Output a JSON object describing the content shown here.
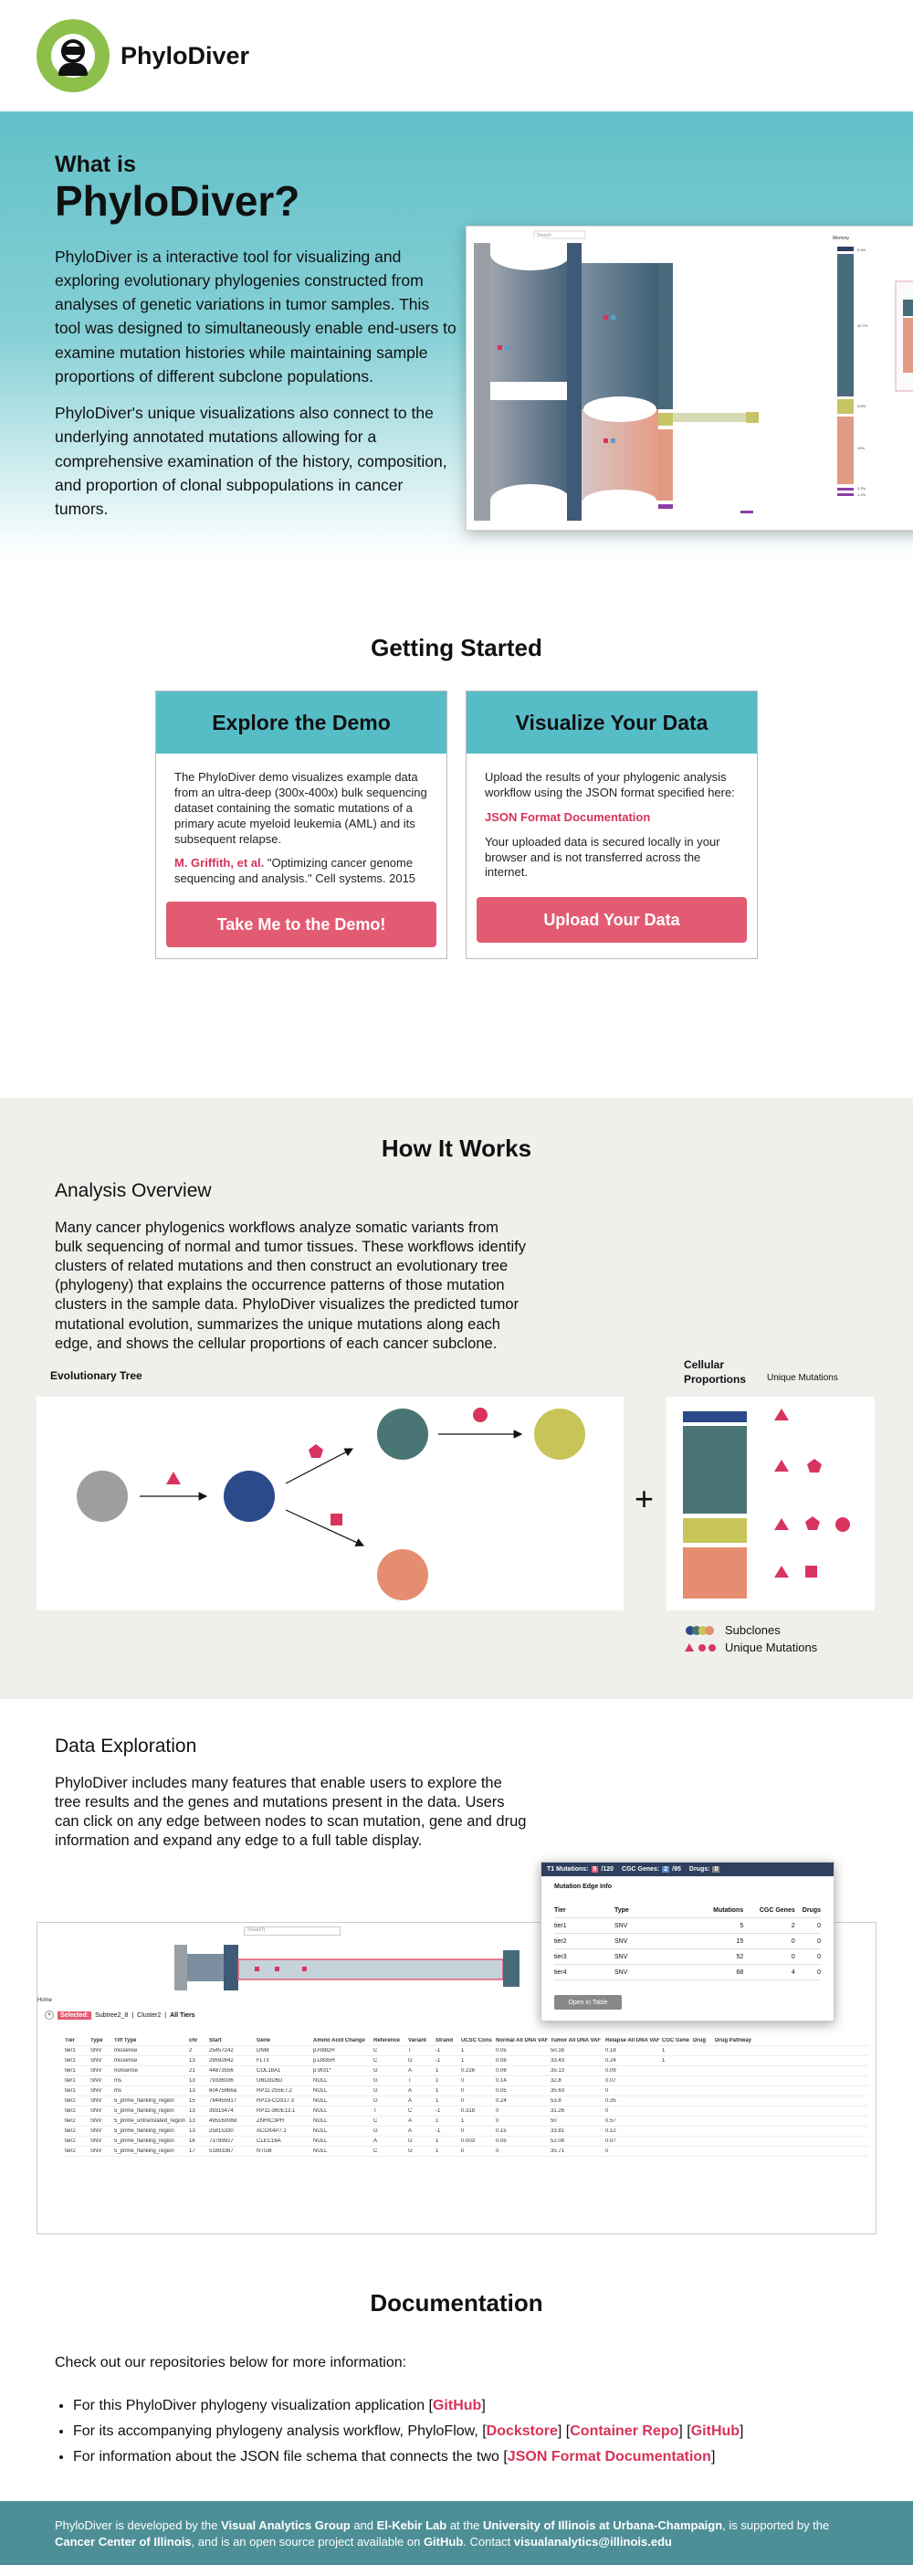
{
  "brand": {
    "name": "PhyloDiver"
  },
  "hero": {
    "pre_title": "What is",
    "title": "PhyloDiver?",
    "para1": "PhyloDiver is a interactive tool for visualizing and exploring evolutionary phylogenies constructed from analyses of genetic variations in tumor samples. This tool was designed to simultaneously enable end-users to examine mutation histories while maintaining sample proportions of different subclone populations.",
    "para2": "PhyloDiver's unique visualizations also connect to the underlying annotated mutations allowing for a comprehensive examination of the history, composition, and proportion of clonal subpopulations in cancer tumors.",
    "shot": {
      "search_placeholder": "Search",
      "memory_label": "Memory",
      "pct_top": "5.4%",
      "pct_mid": "42.7%",
      "pct_low1": "5.8%",
      "pct_low2": "29%",
      "pct_b1": "2.2%",
      "pct_b2": "1.2%"
    }
  },
  "getting_started": {
    "title": "Getting Started",
    "demo": {
      "title": "Explore the Demo",
      "text": "The PhyloDiver demo visualizes example data from an ultra-deep (300x-400x) bulk sequencing dataset containing the somatic mutations of a primary acute myeloid leukemia (AML) and its subsequent relapse.",
      "citation_authors": "M. Griffith, et al.",
      "citation_rest": " \"Optimizing cancer genome sequencing and analysis.\" Cell systems. 2015",
      "button": "Take Me to the Demo!"
    },
    "upload": {
      "title": "Visualize Your Data",
      "text": "Upload the results of your phylogenic analysis workflow using the JSON format specified here:",
      "link": "JSON Format Documentation",
      "text2": "Your uploaded data is secured locally in your browser and is not transferred across the internet.",
      "button": "Upload Your Data"
    }
  },
  "how": {
    "title": "How It Works",
    "overview_title": "Analysis Overview",
    "overview_text": "Many cancer phylogenics workflows analyze somatic variants from bulk sequencing of normal and tumor tissues. These workflows identify clusters of related mutations and then construct an evolutionary tree (phylogeny) that explains the occurrence patterns of those mutation clusters in the sample data. PhyloDiver visualizes the predicted tumor mutational evolution, summarizes the unique mutations along each edge, and shows the cellular proportions of each cancer subclone.",
    "tree_label": "Evolutionary Tree",
    "cell_prop_label": "Cellular Proportions",
    "unique_mut_label": "Unique Mutations",
    "plus": "+",
    "legend_subclones": "Subclones",
    "legend_unique": "Unique Mutations",
    "colors": {
      "gray": "#9e9e9e",
      "navy": "#2a4a8a",
      "teal": "#497574",
      "olive": "#c8c558",
      "salmon": "#e58e6f",
      "pink": "#d8345f"
    }
  },
  "explore": {
    "title": "Data Exploration",
    "text": "PhyloDiver includes many features that enable users to explore the tree results and the genes and mutations present in the data. Users can click on any edge between nodes to scan mutation, gene and drug information and expand any edge to a full table display.",
    "popup": {
      "header_t1": "T1 Mutations:",
      "t1_count": "5",
      "t1_total": "/120",
      "cgc_label": "CGC Genes:",
      "cgc_count": "2",
      "cgc_total": "/95",
      "drugs_label": "Drugs:",
      "drugs_count": "0",
      "section": "Mutation Edge Info",
      "cols": [
        "Tier",
        "Type",
        "Mutations",
        "CGC Genes",
        "Drugs"
      ],
      "rows": [
        [
          "tier1",
          "SNV",
          "5",
          "2",
          "0"
        ],
        [
          "tier2",
          "SNV",
          "15",
          "0",
          "0"
        ],
        [
          "tier3",
          "SNV",
          "52",
          "0",
          "0"
        ],
        [
          "tier4",
          "SNV",
          "68",
          "4",
          "0"
        ]
      ],
      "button": "Open in Table"
    },
    "table": {
      "home": "Home",
      "selected": "Selected:",
      "crumbs": [
        "Subtree2_8",
        "Cluster2",
        "All Tiers"
      ],
      "search_placeholder": "Search",
      "cols": [
        "Tier",
        "Type",
        "Tiff Type",
        "chr",
        "Start",
        "Gene",
        "Amino Acid Change",
        "Reference",
        "Variant",
        "Strand",
        "UCSC Cons",
        "Normal All DNA VAF",
        "Tumor All DNA VAF",
        "Relapse All DNA VAF",
        "CGC Gene",
        "Drug",
        "Drug Pathway"
      ],
      "rows": [
        [
          "tier1",
          "SNV",
          "missense",
          "2",
          "25457242",
          "DNM",
          "p.R882H",
          "C",
          "T",
          "-1",
          "1",
          "0.05",
          "50.16",
          "0.18",
          "1",
          "",
          ""
        ],
        [
          "tier1",
          "SNV",
          "missense",
          "13",
          "28592642",
          "FLT3",
          "p.D835H",
          "C",
          "G",
          "-1",
          "1",
          "0.08",
          "33.43",
          "0.24",
          "1",
          "",
          ""
        ],
        [
          "tier1",
          "SNV",
          "nonsense",
          "21",
          "44873556",
          "COL18A1",
          "p.W31*",
          "G",
          "A",
          "1",
          "0.226",
          "0.06",
          "35.13",
          "0.09",
          "",
          "",
          ""
        ],
        [
          "tier1",
          "SNV",
          "ms",
          "13",
          "79336036",
          "UBO3D6D",
          "NULL",
          "G",
          "T",
          "1",
          "0",
          "0.14",
          "32.8",
          "0.07",
          "",
          "",
          ""
        ],
        [
          "tier1",
          "SNV",
          "ms",
          "13",
          "60475966a",
          "RP11-255E7.2",
          "NULL",
          "G",
          "A",
          "1",
          "0",
          "0.05",
          "35.63",
          "0",
          "",
          "",
          ""
        ],
        [
          "tier2",
          "SNV",
          "5_prime_flanking_region",
          "15",
          "784455917",
          "RP13-CO317.3",
          "NULL",
          "G",
          "A",
          "1",
          "0",
          "0.24",
          "53.8",
          "0.35",
          "",
          "",
          ""
        ],
        [
          "tier2",
          "SNV",
          "5_prime_flanking_region",
          "13",
          "39315474",
          "RP11-360E13.1",
          "NULL",
          "T",
          "C",
          "-1",
          "0.318",
          "0",
          "31.26",
          "0",
          "",
          "",
          ""
        ],
        [
          "tier2",
          "SNV",
          "5_prime_untranslated_region",
          "13",
          "49516008d",
          "ZNHIC3PH",
          "NULL",
          "C",
          "A",
          "1",
          "1",
          "0",
          "50",
          "0.57",
          "",
          "",
          ""
        ],
        [
          "tier2",
          "SNV",
          "5_prime_flanking_region",
          "13",
          "25815330",
          "ACOX4P7.1",
          "NULL",
          "G",
          "A",
          "-1",
          "0",
          "0.15",
          "33.81",
          "0.12",
          "",
          "",
          ""
        ],
        [
          "tier2",
          "SNV",
          "5_prime_flanking_region",
          "16",
          "73789927",
          "CLEC16A",
          "NULL",
          "A",
          "G",
          "1",
          "0.003",
          "0.05",
          "52.08",
          "0.07",
          "",
          "",
          ""
        ],
        [
          "tier2",
          "SNV",
          "5_prime_flanking_region",
          "17",
          "51893387",
          "NTGB",
          "NULL",
          "C",
          "G",
          "1",
          "0",
          "0",
          "35.71",
          "0",
          "",
          "",
          ""
        ]
      ]
    }
  },
  "docs": {
    "title": "Documentation",
    "intro": "Check out our repositories below for more information:",
    "item1_text": "For this PhyloDiver phylogeny visualization application [",
    "item1_link": "GitHub",
    "item2_text": "For its accompanying phylogeny analysis workflow, PhyloFlow, [",
    "item2_link1": "Dockstore",
    "item2_link2": "Container Repo",
    "item2_link3": "GitHub",
    "item3_text": "For information about the JSON file schema that connects the two [",
    "item3_link": "JSON Format Documentation"
  },
  "footer": {
    "t1": "PhyloDiver is developed by the ",
    "b1": "Visual Analytics Group",
    "t2": " and ",
    "b2": "El-Kebir Lab",
    "t3": " at the ",
    "b3": "University of Illinois at Urbana-Champaign",
    "t4": ", is supported by the ",
    "b4": "Cancer Center of Illinois",
    "t5": ", and is an open source project available on ",
    "b5": "GitHub",
    "t6": ". Contact ",
    "b6": "visualanalytics@illinois.edu"
  }
}
